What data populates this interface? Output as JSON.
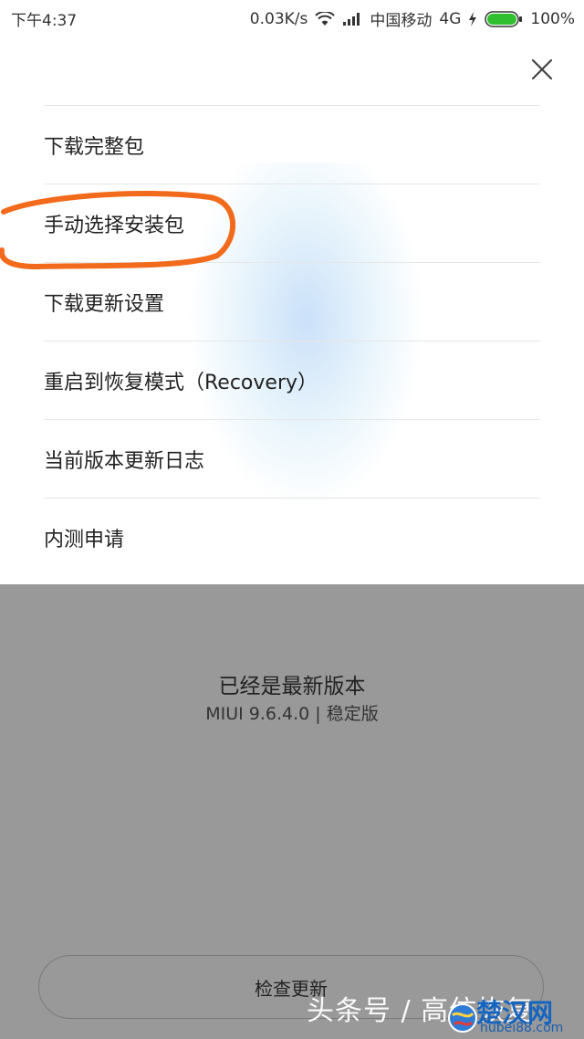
{
  "status_bar": {
    "time": "下午4:37",
    "speed": "0.03K/s",
    "carrier": "中国移动",
    "network": "4G",
    "battery": "100%"
  },
  "menu": {
    "items": [
      {
        "label": "下载完整包"
      },
      {
        "label": "手动选择安装包"
      },
      {
        "label": "下载更新设置"
      },
      {
        "label": "重启到恢复模式（Recovery）"
      },
      {
        "label": "当前版本更新日志"
      },
      {
        "label": "内测申请"
      }
    ]
  },
  "version": {
    "title": "已经是最新版本",
    "subtitle": "MIUI 9.6.4.0 | 稳定版"
  },
  "check_button": {
    "label": "检查更新"
  },
  "watermark": {
    "text": "头条号 / 高仿恢复",
    "brand": "楚汉网",
    "domain": "hubei88.com"
  },
  "colors": {
    "highlight": "#f26a1b",
    "overlay": "#999999",
    "accent": "#1565c0"
  },
  "icons": [
    "wifi-icon",
    "signal-icon",
    "charging-icon",
    "battery-icon",
    "close-icon"
  ]
}
